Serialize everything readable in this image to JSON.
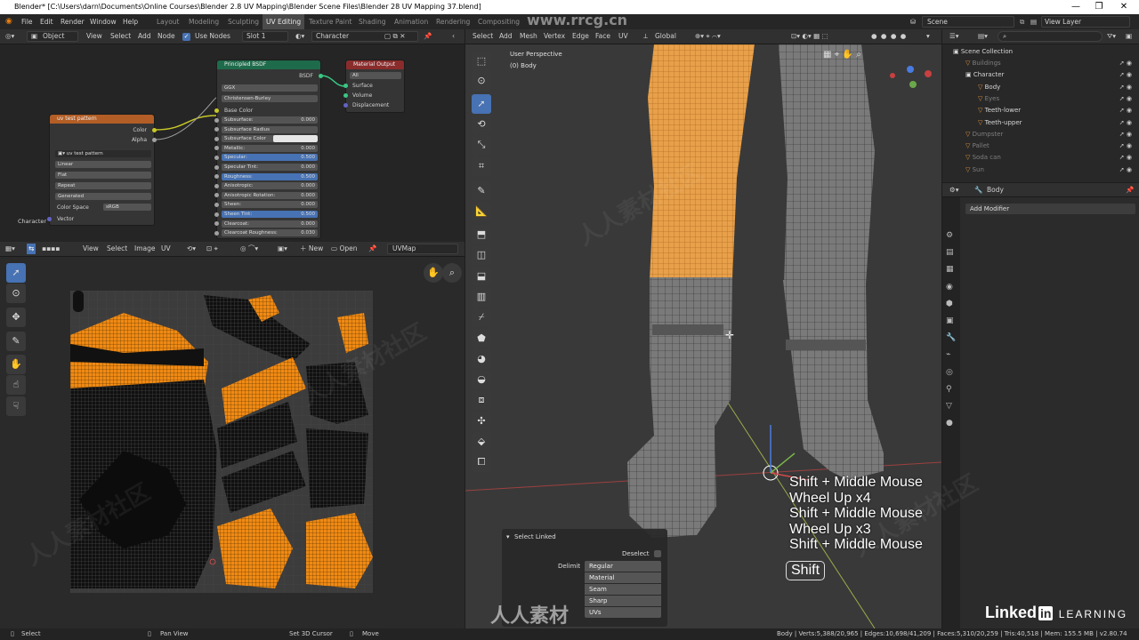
{
  "window": {
    "title": "Blender* [C:\\Users\\darn\\Documents\\Online Courses\\Blender 2.8 UV Mapping\\Blender Scene Files\\Blender 28 UV Mapping 37.blend]",
    "controls": [
      "—",
      "❐",
      "✕"
    ]
  },
  "menu": {
    "items": [
      "File",
      "Edit",
      "Render",
      "Window",
      "Help"
    ],
    "workspaces": [
      "Layout",
      "Modeling",
      "Sculpting",
      "UV Editing",
      "Texture Paint",
      "Shading",
      "Animation",
      "Rendering",
      "Compositing"
    ],
    "active_workspace": "UV Editing",
    "scene": "Scene",
    "view_layer": "View Layer"
  },
  "node_header": {
    "object_mode": "Object",
    "items": [
      "View",
      "Select",
      "Add",
      "Node"
    ],
    "use_nodes": "Use Nodes",
    "slot": "Slot 1",
    "material": "Character"
  },
  "nodes": {
    "uv_test": {
      "title": "uv test pattern",
      "out_color": "Color",
      "out_alpha": "Alpha",
      "image_name": "uv test pattern",
      "fields": [
        "Linear",
        "Flat",
        "Repeat",
        "Generated"
      ],
      "color_space_label": "Color Space",
      "color_space": "sRGB",
      "vector": "Vector"
    },
    "bsdf": {
      "title": "Principled BSDF",
      "out": "BSDF",
      "dist": "GGX",
      "sss": "Christensen-Burley",
      "base_color": "Base Color",
      "rows": [
        {
          "label": "Subsurface:",
          "value": "0.000",
          "blue": false
        },
        {
          "label": "Subsurface Radius",
          "value": "",
          "blue": false
        },
        {
          "label": "Subsurface Color",
          "value": "",
          "blue": false
        },
        {
          "label": "Metallic:",
          "value": "0.000",
          "blue": false
        },
        {
          "label": "Specular:",
          "value": "0.500",
          "blue": true
        },
        {
          "label": "Specular Tint:",
          "value": "0.000",
          "blue": false
        },
        {
          "label": "Roughness:",
          "value": "0.500",
          "blue": true
        },
        {
          "label": "Anisotropic:",
          "value": "0.000",
          "blue": false
        },
        {
          "label": "Anisotropic Rotation:",
          "value": "0.000",
          "blue": false
        },
        {
          "label": "Sheen:",
          "value": "0.000",
          "blue": false
        },
        {
          "label": "Sheen Tint:",
          "value": "0.500",
          "blue": true
        },
        {
          "label": "Clearcoat:",
          "value": "0.000",
          "blue": false
        },
        {
          "label": "Clearcoat Roughness:",
          "value": "0.030",
          "blue": false
        }
      ]
    },
    "output": {
      "title": "Material Output",
      "target": "All",
      "inputs": [
        "Surface",
        "Volume",
        "Displacement"
      ]
    },
    "frame_label": "Character"
  },
  "uv_header": {
    "items": [
      "View",
      "Select",
      "Image",
      "UV"
    ],
    "new": "New",
    "open": "Open",
    "uvmap": "UVMap"
  },
  "viewport_header": {
    "items": [
      "Select",
      "Add",
      "Mesh",
      "Vertex",
      "Edge",
      "Face",
      "UV"
    ],
    "orientation": "Global"
  },
  "viewport": {
    "perspective": "User Perspective",
    "object": "(0) Body"
  },
  "key_overlay": {
    "lines": [
      "Shift + Middle Mouse",
      "Wheel Up x4",
      "Shift + Middle Mouse",
      "Wheel Up x3",
      "Shift + Middle Mouse"
    ],
    "current_key": "Shift"
  },
  "select_linked": {
    "title": "Select Linked",
    "deselect": "Deselect",
    "delimit": "Delimit",
    "options": [
      "Regular",
      "Material",
      "Seam",
      "Sharp",
      "UVs"
    ]
  },
  "outliner": {
    "root": "Scene Collection",
    "items": [
      {
        "label": "Buildings",
        "dim": true,
        "indent": 1,
        "sel": false
      },
      {
        "label": "Character",
        "dim": false,
        "indent": 1,
        "sel": false
      },
      {
        "label": "Body",
        "dim": false,
        "indent": 2,
        "sel": false
      },
      {
        "label": "Eyes",
        "dim": true,
        "indent": 2,
        "sel": false
      },
      {
        "label": "Teeth-lower",
        "dim": false,
        "indent": 2,
        "sel": false
      },
      {
        "label": "Teeth-upper",
        "dim": false,
        "indent": 2,
        "sel": false
      },
      {
        "label": "Dumpster",
        "dim": true,
        "indent": 1,
        "sel": false
      },
      {
        "label": "Pallet",
        "dim": true,
        "indent": 1,
        "sel": false
      },
      {
        "label": "Soda can",
        "dim": true,
        "indent": 1,
        "sel": false
      },
      {
        "label": "Sun",
        "dim": true,
        "indent": 1,
        "sel": false
      }
    ]
  },
  "properties": {
    "object": "Body",
    "add_modifier": "Add Modifier"
  },
  "status": {
    "select": "Select",
    "pan": "Pan View",
    "cursor": "Set 3D Cursor",
    "move": "Move",
    "stats": "Body | Verts:5,388/20,965 | Edges:10,698/41,209 | Faces:5,310/20,259 | Tris:40,518 | Mem: 155.5 MB | v2.80.74"
  },
  "branding": {
    "linkedin": "Linked",
    "in": "in",
    "learning": "LEARNING",
    "watermark": "www.rrcg.cn",
    "cn_wm": "人人素材社区",
    "cn_logo": "人人素材"
  },
  "colors": {
    "accent": "#4772b3",
    "selection": "#ff8c00",
    "bsdf_header": "#1e6b4b",
    "output_header": "#8a2c2c",
    "texture_header": "#b35e26"
  }
}
